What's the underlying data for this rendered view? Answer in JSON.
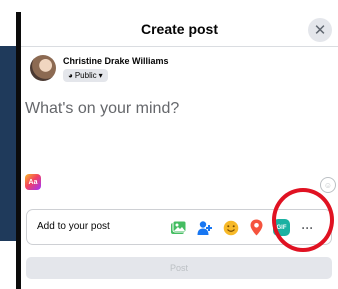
{
  "header": {
    "title": "Create post",
    "close_glyph": "✕"
  },
  "user": {
    "name": "Christine Drake Williams",
    "privacy_glyph": "◕",
    "privacy": "Public",
    "privacy_caret": "▾"
  },
  "composer": {
    "placeholder": "What's on your mind?"
  },
  "text_style": {
    "label": "Aa"
  },
  "emoji_glyph": "☺",
  "add_to_post": {
    "label": "Add to your post",
    "tools": [
      {
        "icon": "photo-video-icon",
        "color": "#45bd62"
      },
      {
        "icon": "tag-people-icon",
        "color": "#1877f2"
      },
      {
        "icon": "feeling-activity-icon",
        "color": "#f7b928"
      },
      {
        "icon": "check-in-icon",
        "color": "#f5533d"
      },
      {
        "icon": "gif-icon",
        "label": "GIF",
        "color": "#1cb1a2"
      },
      {
        "icon": "more-options-icon",
        "label": "···"
      }
    ]
  },
  "post_button": {
    "label": "Post"
  },
  "annotation": {
    "shape": "circle",
    "color": "#e01222"
  }
}
